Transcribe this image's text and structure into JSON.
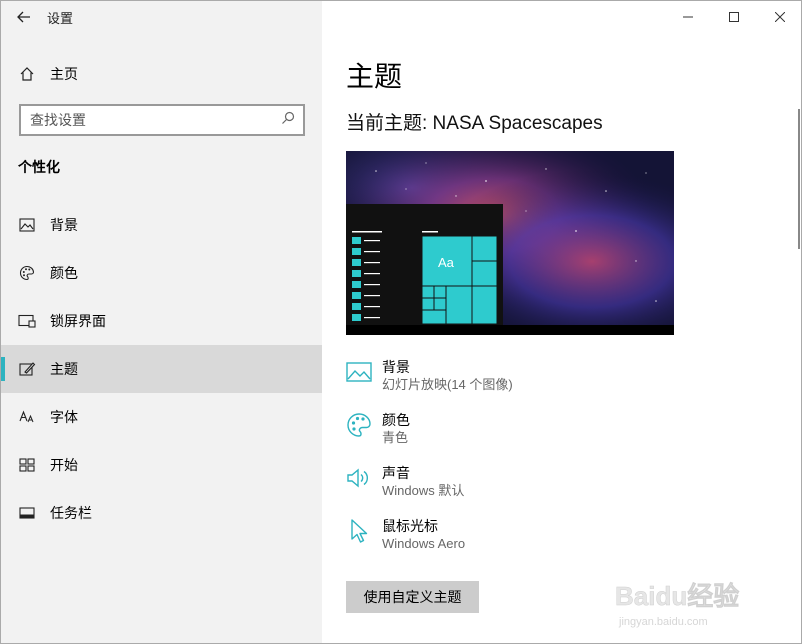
{
  "window": {
    "title": "设置"
  },
  "sidebar": {
    "home_label": "主页",
    "search_placeholder": "查找设置",
    "section_title": "个性化",
    "items": [
      {
        "label": "背景",
        "icon": "picture-icon"
      },
      {
        "label": "颜色",
        "icon": "palette-icon"
      },
      {
        "label": "锁屏界面",
        "icon": "lock-screen-icon"
      },
      {
        "label": "主题",
        "icon": "theme-icon",
        "active": true
      },
      {
        "label": "字体",
        "icon": "font-icon"
      },
      {
        "label": "开始",
        "icon": "start-icon"
      },
      {
        "label": "任务栏",
        "icon": "taskbar-icon"
      }
    ]
  },
  "main": {
    "title": "主题",
    "current_theme": "当前主题: NASA Spacescapes",
    "preview_tile_label": "Aa",
    "settings": [
      {
        "title": "背景",
        "value": "幻灯片放映(14 个图像)",
        "icon": "picture-icon"
      },
      {
        "title": "颜色",
        "value": "青色",
        "icon": "palette-icon"
      },
      {
        "title": "声音",
        "value": "Windows 默认",
        "icon": "speaker-icon"
      },
      {
        "title": "鼠标光标",
        "value": "Windows Aero",
        "icon": "cursor-icon"
      }
    ],
    "custom_button_label": "使用自定义主题"
  },
  "colors": {
    "accent": "#2db3c0",
    "sidebar_bg": "#f2f2f2",
    "active_bg": "#d9d9d9"
  },
  "watermark": {
    "text": "Baidu经验",
    "subtext": "jingyan.baidu.com"
  }
}
